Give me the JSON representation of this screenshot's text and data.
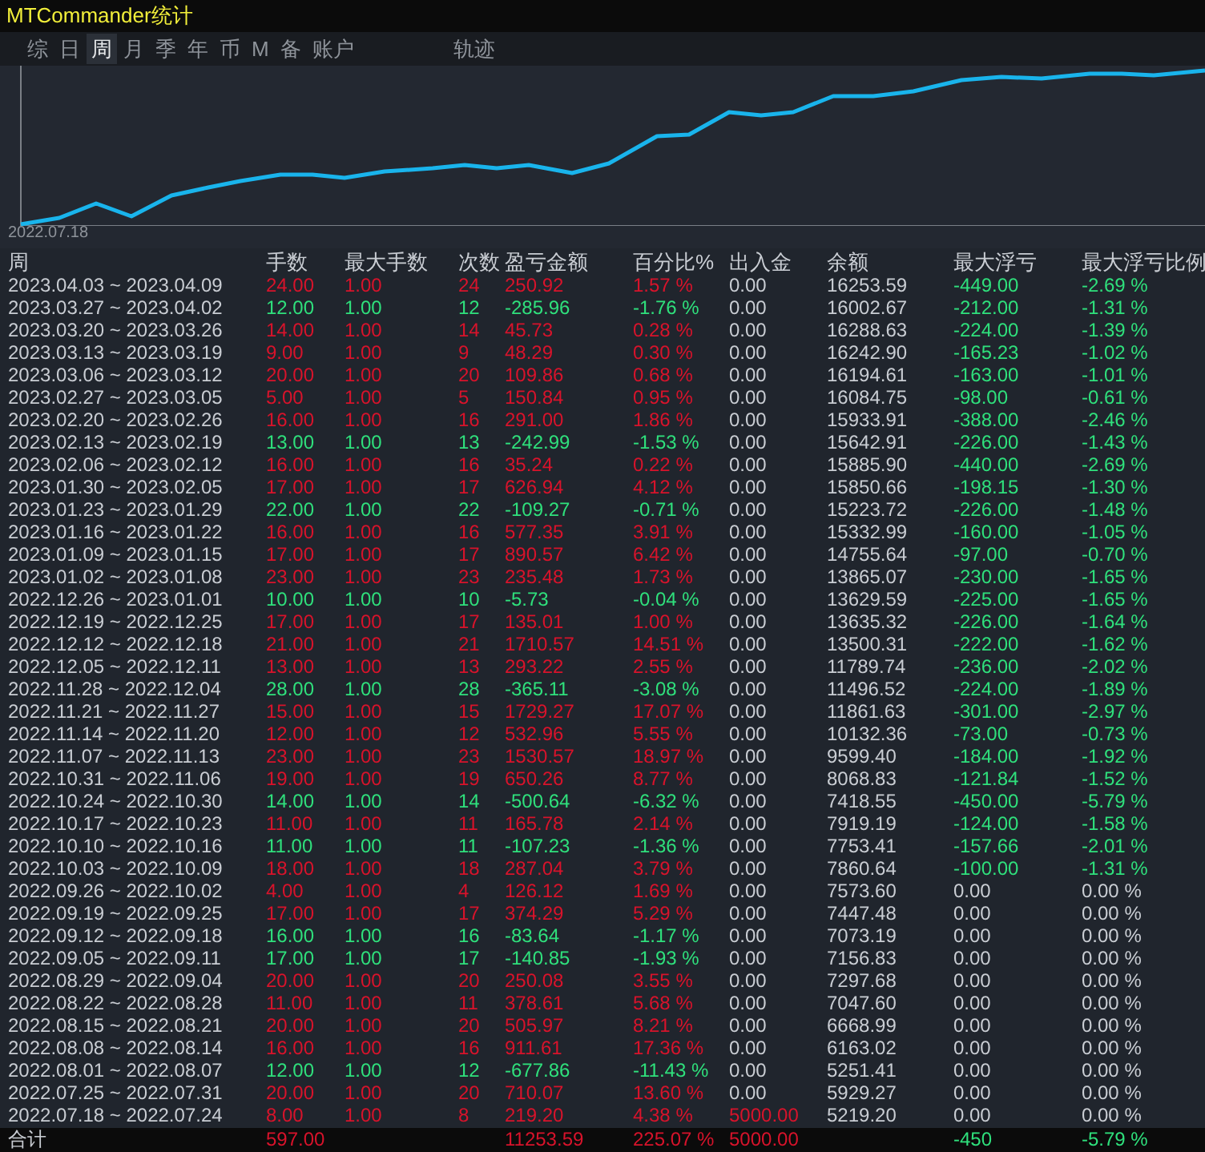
{
  "window": {
    "title": "MTCommander统计"
  },
  "tabs": [
    {
      "label": "综",
      "selected": false,
      "kind": "tab"
    },
    {
      "label": "日",
      "selected": false,
      "kind": "tab"
    },
    {
      "label": "周",
      "selected": true,
      "kind": "tab"
    },
    {
      "label": "月",
      "selected": false,
      "kind": "tab"
    },
    {
      "label": "季",
      "selected": false,
      "kind": "tab"
    },
    {
      "label": "年",
      "selected": false,
      "kind": "tab"
    },
    {
      "label": "币",
      "selected": false,
      "kind": "tab"
    },
    {
      "label": "M",
      "selected": false,
      "kind": "tab"
    },
    {
      "label": "备",
      "selected": false,
      "kind": "tab"
    },
    {
      "label": "账户",
      "selected": false,
      "kind": "tab"
    },
    {
      "label": "轨迹",
      "selected": false,
      "kind": "spaced"
    }
  ],
  "chart": {
    "start_label": "2022.07.18"
  },
  "table": {
    "columns": [
      "周",
      "手数",
      "最大手数",
      "次数",
      "盈亏金额",
      "百分比%",
      "出入金",
      "余额",
      "最大浮亏",
      "最大浮亏比例"
    ],
    "rows": [
      {
        "profit": true,
        "has_deposit": false,
        "has_drawdown": true,
        "cells": [
          "2023.04.03 ~ 2023.04.09",
          "24.00",
          "1.00",
          "24",
          "250.92",
          "1.57 %",
          "0.00",
          "16253.59",
          "-449.00",
          "-2.69 %"
        ]
      },
      {
        "profit": false,
        "has_deposit": false,
        "has_drawdown": true,
        "cells": [
          "2023.03.27 ~ 2023.04.02",
          "12.00",
          "1.00",
          "12",
          "-285.96",
          "-1.76 %",
          "0.00",
          "16002.67",
          "-212.00",
          "-1.31 %"
        ]
      },
      {
        "profit": true,
        "has_deposit": false,
        "has_drawdown": true,
        "cells": [
          "2023.03.20 ~ 2023.03.26",
          "14.00",
          "1.00",
          "14",
          "45.73",
          "0.28 %",
          "0.00",
          "16288.63",
          "-224.00",
          "-1.39 %"
        ]
      },
      {
        "profit": true,
        "has_deposit": false,
        "has_drawdown": true,
        "cells": [
          "2023.03.13 ~ 2023.03.19",
          "9.00",
          "1.00",
          "9",
          "48.29",
          "0.30 %",
          "0.00",
          "16242.90",
          "-165.23",
          "-1.02 %"
        ]
      },
      {
        "profit": true,
        "has_deposit": false,
        "has_drawdown": true,
        "cells": [
          "2023.03.06 ~ 2023.03.12",
          "20.00",
          "1.00",
          "20",
          "109.86",
          "0.68 %",
          "0.00",
          "16194.61",
          "-163.00",
          "-1.01 %"
        ]
      },
      {
        "profit": true,
        "has_deposit": false,
        "has_drawdown": true,
        "cells": [
          "2023.02.27 ~ 2023.03.05",
          "5.00",
          "1.00",
          "5",
          "150.84",
          "0.95 %",
          "0.00",
          "16084.75",
          "-98.00",
          "-0.61 %"
        ]
      },
      {
        "profit": true,
        "has_deposit": false,
        "has_drawdown": true,
        "cells": [
          "2023.02.20 ~ 2023.02.26",
          "16.00",
          "1.00",
          "16",
          "291.00",
          "1.86 %",
          "0.00",
          "15933.91",
          "-388.00",
          "-2.46 %"
        ]
      },
      {
        "profit": false,
        "has_deposit": false,
        "has_drawdown": true,
        "cells": [
          "2023.02.13 ~ 2023.02.19",
          "13.00",
          "1.00",
          "13",
          "-242.99",
          "-1.53 %",
          "0.00",
          "15642.91",
          "-226.00",
          "-1.43 %"
        ]
      },
      {
        "profit": true,
        "has_deposit": false,
        "has_drawdown": true,
        "cells": [
          "2023.02.06 ~ 2023.02.12",
          "16.00",
          "1.00",
          "16",
          "35.24",
          "0.22 %",
          "0.00",
          "15885.90",
          "-440.00",
          "-2.69 %"
        ]
      },
      {
        "profit": true,
        "has_deposit": false,
        "has_drawdown": true,
        "cells": [
          "2023.01.30 ~ 2023.02.05",
          "17.00",
          "1.00",
          "17",
          "626.94",
          "4.12 %",
          "0.00",
          "15850.66",
          "-198.15",
          "-1.30 %"
        ]
      },
      {
        "profit": false,
        "has_deposit": false,
        "has_drawdown": true,
        "cells": [
          "2023.01.23 ~ 2023.01.29",
          "22.00",
          "1.00",
          "22",
          "-109.27",
          "-0.71 %",
          "0.00",
          "15223.72",
          "-226.00",
          "-1.48 %"
        ]
      },
      {
        "profit": true,
        "has_deposit": false,
        "has_drawdown": true,
        "cells": [
          "2023.01.16 ~ 2023.01.22",
          "16.00",
          "1.00",
          "16",
          "577.35",
          "3.91 %",
          "0.00",
          "15332.99",
          "-160.00",
          "-1.05 %"
        ]
      },
      {
        "profit": true,
        "has_deposit": false,
        "has_drawdown": true,
        "cells": [
          "2023.01.09 ~ 2023.01.15",
          "17.00",
          "1.00",
          "17",
          "890.57",
          "6.42 %",
          "0.00",
          "14755.64",
          "-97.00",
          "-0.70 %"
        ]
      },
      {
        "profit": true,
        "has_deposit": false,
        "has_drawdown": true,
        "cells": [
          "2023.01.02 ~ 2023.01.08",
          "23.00",
          "1.00",
          "23",
          "235.48",
          "1.73 %",
          "0.00",
          "13865.07",
          "-230.00",
          "-1.65 %"
        ]
      },
      {
        "profit": false,
        "has_deposit": false,
        "has_drawdown": true,
        "cells": [
          "2022.12.26 ~ 2023.01.01",
          "10.00",
          "1.00",
          "10",
          "-5.73",
          "-0.04 %",
          "0.00",
          "13629.59",
          "-225.00",
          "-1.65 %"
        ]
      },
      {
        "profit": true,
        "has_deposit": false,
        "has_drawdown": true,
        "cells": [
          "2022.12.19 ~ 2022.12.25",
          "17.00",
          "1.00",
          "17",
          "135.01",
          "1.00 %",
          "0.00",
          "13635.32",
          "-226.00",
          "-1.64 %"
        ]
      },
      {
        "profit": true,
        "has_deposit": false,
        "has_drawdown": true,
        "cells": [
          "2022.12.12 ~ 2022.12.18",
          "21.00",
          "1.00",
          "21",
          "1710.57",
          "14.51 %",
          "0.00",
          "13500.31",
          "-222.00",
          "-1.62 %"
        ]
      },
      {
        "profit": true,
        "has_deposit": false,
        "has_drawdown": true,
        "cells": [
          "2022.12.05 ~ 2022.12.11",
          "13.00",
          "1.00",
          "13",
          "293.22",
          "2.55 %",
          "0.00",
          "11789.74",
          "-236.00",
          "-2.02 %"
        ]
      },
      {
        "profit": false,
        "has_deposit": false,
        "has_drawdown": true,
        "cells": [
          "2022.11.28 ~ 2022.12.04",
          "28.00",
          "1.00",
          "28",
          "-365.11",
          "-3.08 %",
          "0.00",
          "11496.52",
          "-224.00",
          "-1.89 %"
        ]
      },
      {
        "profit": true,
        "has_deposit": false,
        "has_drawdown": true,
        "cells": [
          "2022.11.21 ~ 2022.11.27",
          "15.00",
          "1.00",
          "15",
          "1729.27",
          "17.07 %",
          "0.00",
          "11861.63",
          "-301.00",
          "-2.97 %"
        ]
      },
      {
        "profit": true,
        "has_deposit": false,
        "has_drawdown": true,
        "cells": [
          "2022.11.14 ~ 2022.11.20",
          "12.00",
          "1.00",
          "12",
          "532.96",
          "5.55 %",
          "0.00",
          "10132.36",
          "-73.00",
          "-0.73 %"
        ]
      },
      {
        "profit": true,
        "has_deposit": false,
        "has_drawdown": true,
        "cells": [
          "2022.11.07 ~ 2022.11.13",
          "23.00",
          "1.00",
          "23",
          "1530.57",
          "18.97 %",
          "0.00",
          "9599.40",
          "-184.00",
          "-1.92 %"
        ]
      },
      {
        "profit": true,
        "has_deposit": false,
        "has_drawdown": true,
        "cells": [
          "2022.10.31 ~ 2022.11.06",
          "19.00",
          "1.00",
          "19",
          "650.26",
          "8.77 %",
          "0.00",
          "8068.83",
          "-121.84",
          "-1.52 %"
        ]
      },
      {
        "profit": false,
        "has_deposit": false,
        "has_drawdown": true,
        "cells": [
          "2022.10.24 ~ 2022.10.30",
          "14.00",
          "1.00",
          "14",
          "-500.64",
          "-6.32 %",
          "0.00",
          "7418.55",
          "-450.00",
          "-5.79 %"
        ]
      },
      {
        "profit": true,
        "has_deposit": false,
        "has_drawdown": true,
        "cells": [
          "2022.10.17 ~ 2022.10.23",
          "11.00",
          "1.00",
          "11",
          "165.78",
          "2.14 %",
          "0.00",
          "7919.19",
          "-124.00",
          "-1.58 %"
        ]
      },
      {
        "profit": false,
        "has_deposit": false,
        "has_drawdown": true,
        "cells": [
          "2022.10.10 ~ 2022.10.16",
          "11.00",
          "1.00",
          "11",
          "-107.23",
          "-1.36 %",
          "0.00",
          "7753.41",
          "-157.66",
          "-2.01 %"
        ]
      },
      {
        "profit": true,
        "has_deposit": false,
        "has_drawdown": true,
        "cells": [
          "2022.10.03 ~ 2022.10.09",
          "18.00",
          "1.00",
          "18",
          "287.04",
          "3.79 %",
          "0.00",
          "7860.64",
          "-100.00",
          "-1.31 %"
        ]
      },
      {
        "profit": true,
        "has_deposit": false,
        "has_drawdown": false,
        "cells": [
          "2022.09.26 ~ 2022.10.02",
          "4.00",
          "1.00",
          "4",
          "126.12",
          "1.69 %",
          "0.00",
          "7573.60",
          "0.00",
          "0.00 %"
        ]
      },
      {
        "profit": true,
        "has_deposit": false,
        "has_drawdown": false,
        "cells": [
          "2022.09.19 ~ 2022.09.25",
          "17.00",
          "1.00",
          "17",
          "374.29",
          "5.29 %",
          "0.00",
          "7447.48",
          "0.00",
          "0.00 %"
        ]
      },
      {
        "profit": false,
        "has_deposit": false,
        "has_drawdown": false,
        "cells": [
          "2022.09.12 ~ 2022.09.18",
          "16.00",
          "1.00",
          "16",
          "-83.64",
          "-1.17 %",
          "0.00",
          "7073.19",
          "0.00",
          "0.00 %"
        ]
      },
      {
        "profit": false,
        "has_deposit": false,
        "has_drawdown": false,
        "cells": [
          "2022.09.05 ~ 2022.09.11",
          "17.00",
          "1.00",
          "17",
          "-140.85",
          "-1.93 %",
          "0.00",
          "7156.83",
          "0.00",
          "0.00 %"
        ]
      },
      {
        "profit": true,
        "has_deposit": false,
        "has_drawdown": false,
        "cells": [
          "2022.08.29 ~ 2022.09.04",
          "20.00",
          "1.00",
          "20",
          "250.08",
          "3.55 %",
          "0.00",
          "7297.68",
          "0.00",
          "0.00 %"
        ]
      },
      {
        "profit": true,
        "has_deposit": false,
        "has_drawdown": false,
        "cells": [
          "2022.08.22 ~ 2022.08.28",
          "11.00",
          "1.00",
          "11",
          "378.61",
          "5.68 %",
          "0.00",
          "7047.60",
          "0.00",
          "0.00 %"
        ]
      },
      {
        "profit": true,
        "has_deposit": false,
        "has_drawdown": false,
        "cells": [
          "2022.08.15 ~ 2022.08.21",
          "20.00",
          "1.00",
          "20",
          "505.97",
          "8.21 %",
          "0.00",
          "6668.99",
          "0.00",
          "0.00 %"
        ]
      },
      {
        "profit": true,
        "has_deposit": false,
        "has_drawdown": false,
        "cells": [
          "2022.08.08 ~ 2022.08.14",
          "16.00",
          "1.00",
          "16",
          "911.61",
          "17.36 %",
          "0.00",
          "6163.02",
          "0.00",
          "0.00 %"
        ]
      },
      {
        "profit": false,
        "has_deposit": false,
        "has_drawdown": false,
        "cells": [
          "2022.08.01 ~ 2022.08.07",
          "12.00",
          "1.00",
          "12",
          "-677.86",
          "-11.43 %",
          "0.00",
          "5251.41",
          "0.00",
          "0.00 %"
        ]
      },
      {
        "profit": true,
        "has_deposit": false,
        "has_drawdown": false,
        "cells": [
          "2022.07.25 ~ 2022.07.31",
          "20.00",
          "1.00",
          "20",
          "710.07",
          "13.60 %",
          "0.00",
          "5929.27",
          "0.00",
          "0.00 %"
        ]
      },
      {
        "profit": true,
        "has_deposit": true,
        "has_drawdown": false,
        "cells": [
          "2022.07.18 ~ 2022.07.24",
          "8.00",
          "1.00",
          "8",
          "219.20",
          "4.38 %",
          "5000.00",
          "5219.20",
          "0.00",
          "0.00 %"
        ]
      }
    ],
    "total": {
      "label": "合计",
      "lots": "597.00",
      "pnl": "11253.59",
      "percent": "225.07 %",
      "deposit": "5000.00",
      "max_drawdown": "-450",
      "max_drawdown_pct": "-5.79 %"
    }
  }
}
